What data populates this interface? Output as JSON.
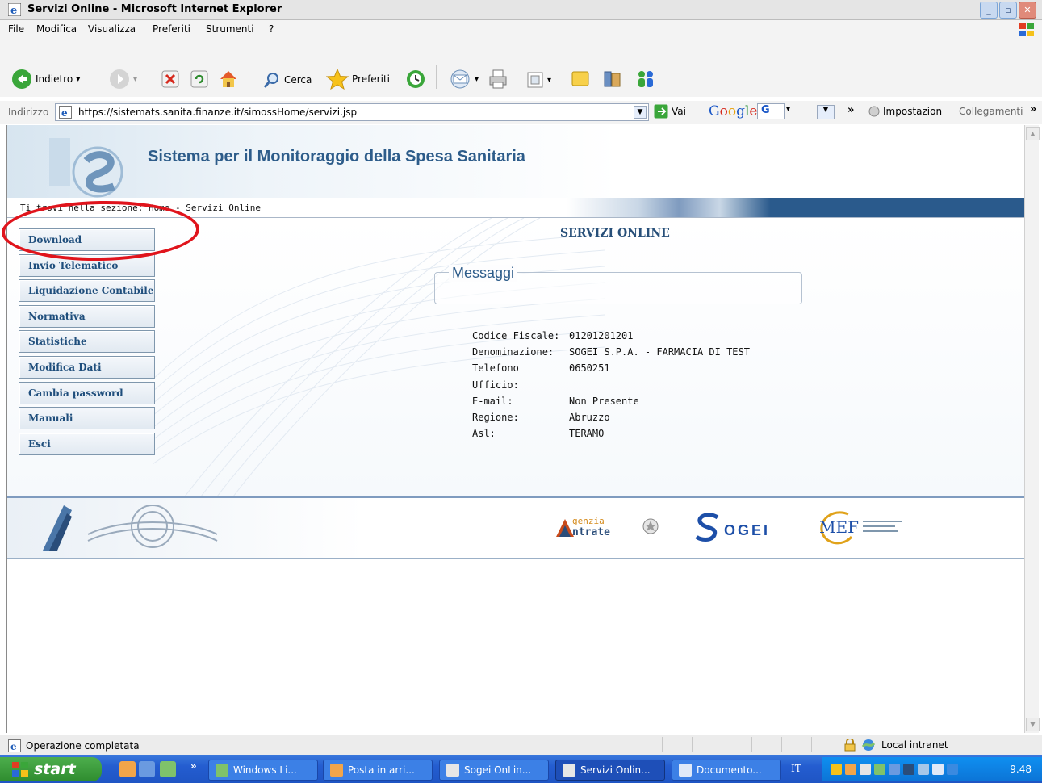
{
  "window": {
    "title": "Servizi Online - Microsoft Internet Explorer"
  },
  "menu": [
    "File",
    "Modifica",
    "Visualizza",
    "Preferiti",
    "Strumenti",
    "?"
  ],
  "toolbar": {
    "back_label": "Indietro",
    "search_label": "Cerca",
    "favorites_label": "Preferiti"
  },
  "address": {
    "label": "Indirizzo",
    "url": "https://sistemats.sanita.finanze.it/simossHome/servizi.jsp",
    "go_label": "Vai",
    "google_text": "Google",
    "google_box": "G",
    "settings_label": "Impostazion",
    "links_label": "Collegamenti"
  },
  "page": {
    "header_title": "Sistema per il Monitoraggio della Spesa Sanitaria",
    "breadcrumb": "Ti trovi nella sezione: Home - Servizi Online",
    "nav": [
      "Download",
      "Invio Telematico",
      "Liquidazione Contabile",
      "Normativa",
      "Statistiche",
      "Modifica Dati",
      "Cambia password",
      "Manuali",
      "Esci"
    ],
    "section_title": "SERVIZI ONLINE",
    "messages_legend": "Messaggi",
    "info": [
      {
        "label": "Codice Fiscale:",
        "value": "01201201201"
      },
      {
        "label": "Denominazione:",
        "value": "SOGEI S.P.A. - FARMACIA DI TEST"
      },
      {
        "label": "Telefono Ufficio:",
        "value": "0650251"
      },
      {
        "label": "E-mail:",
        "value": "Non Presente"
      },
      {
        "label": "Regione:",
        "value": "Abruzzo"
      },
      {
        "label": "Asl:",
        "value": "TERAMO"
      }
    ],
    "footer_logos": {
      "agenzia_top": "genzia",
      "agenzia_bottom": "ntrate",
      "sogei": "OGEI",
      "mef": "MEF"
    }
  },
  "status": {
    "text": "Operazione completata",
    "zone": "Local intranet"
  },
  "taskbar": {
    "start_label": "start",
    "tasks": [
      "Windows Li...",
      "Posta in arri...",
      "Sogei OnLin...",
      "Servizi Onlin...",
      "Documento..."
    ],
    "language": "IT",
    "clock": "9.48"
  },
  "colors": {
    "accent_blue": "#2d5c8a",
    "nav_text": "#1f4e7c",
    "annotation_red": "#e0141c"
  }
}
